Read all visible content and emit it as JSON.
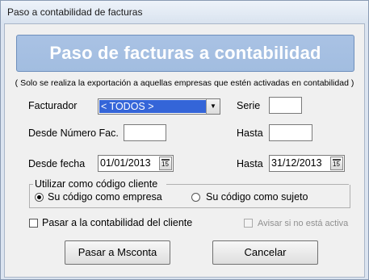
{
  "window": {
    "title": "Paso a contabilidad de facturas"
  },
  "banner": {
    "title": "Paso de facturas a contabilidad"
  },
  "note": "( Solo se realiza la exportación a aquellas empresas que estén activadas en contabilidad )",
  "form": {
    "facturador_label": "Facturador",
    "facturador_value": "< TODOS >",
    "serie_label": "Serie",
    "serie_value": "",
    "desde_numero_label": "Desde Número Fac.",
    "desde_numero_value": "",
    "hasta_numero_label": "Hasta",
    "hasta_numero_value": "",
    "desde_fecha_label": "Desde fecha",
    "desde_fecha_value": "01/01/2013",
    "hasta_fecha_label": "Hasta",
    "hasta_fecha_value": "31/12/2013",
    "calendar_button_text": "15"
  },
  "codigo_cliente": {
    "legend": "Utilizar como código cliente",
    "options": [
      {
        "label": "Su código como empresa",
        "selected": true
      },
      {
        "label": "Su código como sujeto",
        "selected": false
      }
    ]
  },
  "checks": {
    "pasar_contabilidad_cliente": {
      "label": "Pasar a la contabilidad del cliente",
      "checked": false
    },
    "avisar": {
      "label": "Avisar si no está activa",
      "checked": false,
      "enabled": false
    }
  },
  "buttons": {
    "pasar": "Pasar a Msconta",
    "cancelar": "Cancelar"
  },
  "colors": {
    "banner": "#a7c0e3",
    "selection": "#3465d8",
    "client_bg": "#f0f0f0"
  }
}
